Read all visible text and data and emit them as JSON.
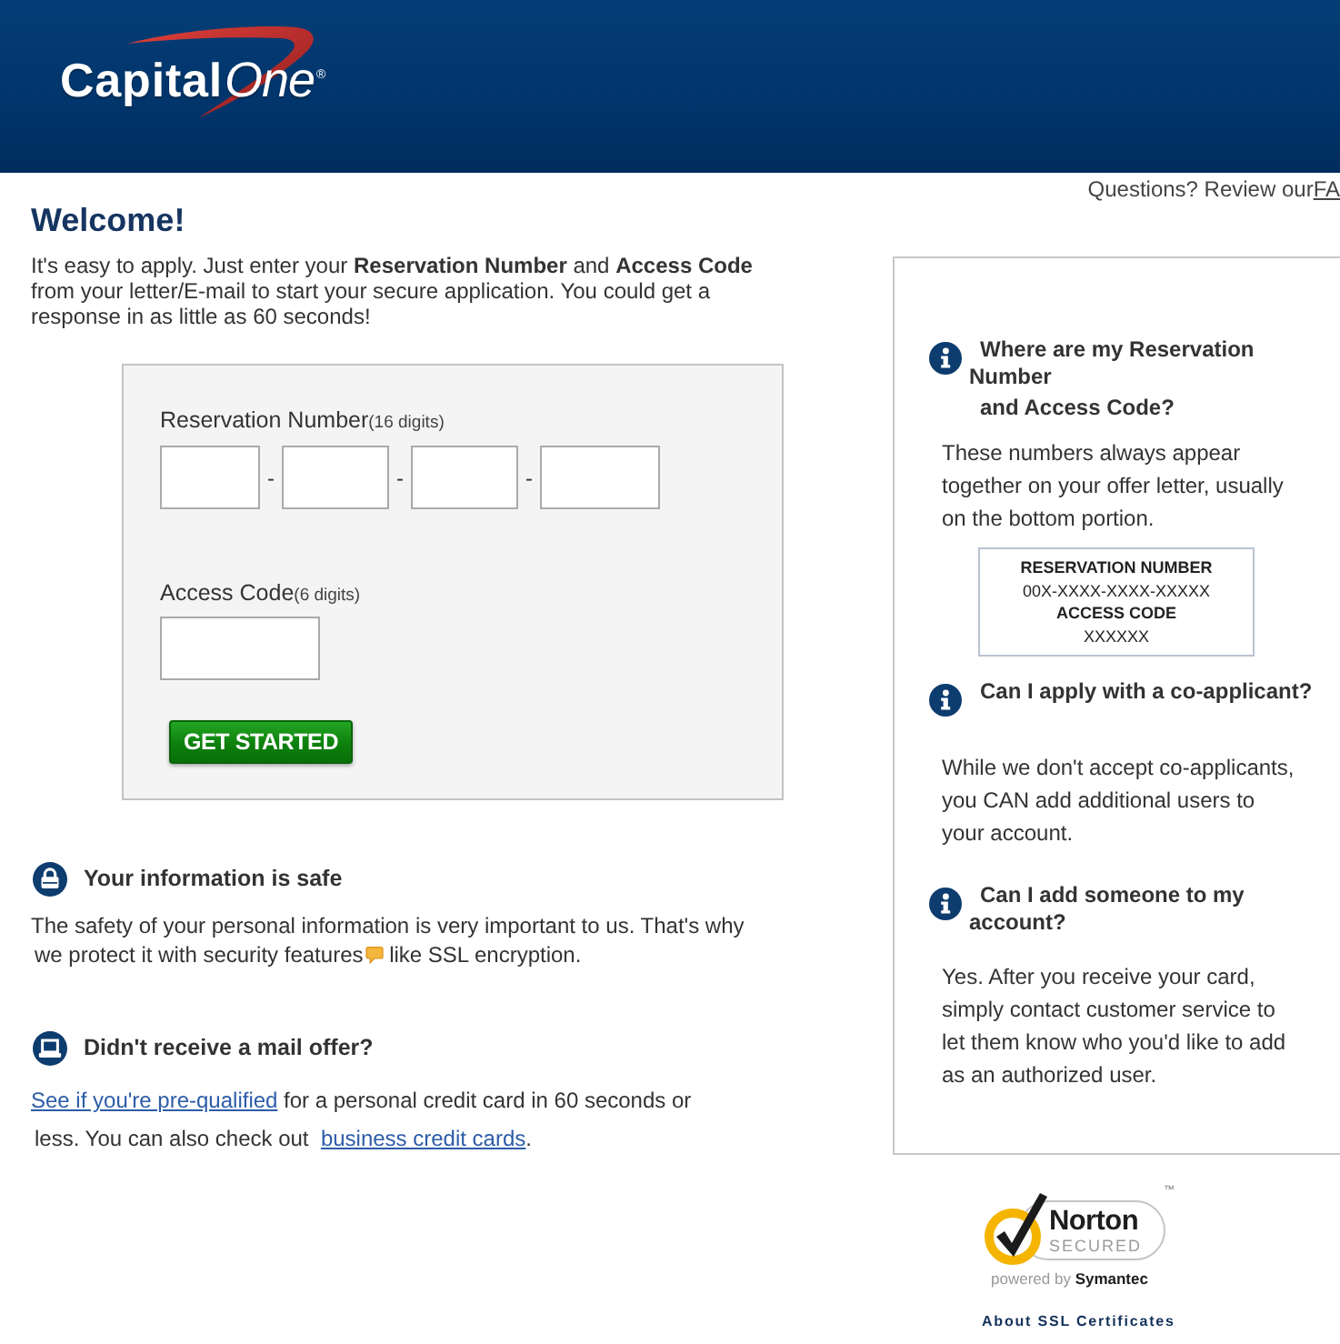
{
  "header": {
    "logo": {
      "bold": "Capital",
      "light": "One",
      "mark": "®"
    }
  },
  "help_bar": {
    "text": "Questions? Review our",
    "link": "FA"
  },
  "welcome": {
    "title": "Welcome!",
    "intro": "It's easy to apply. Just enter your **Reservation Number** and **Access Code** from your letter/E-mail to start your secure application. You could get a response in as little as 60 seconds!"
  },
  "form": {
    "reservation": {
      "label": "Reservation Number",
      "hint": "(16 digits)",
      "separators": [
        "-",
        "-",
        "-"
      ]
    },
    "access_code": {
      "label": "Access Code",
      "hint": "(6 digits)"
    },
    "submit": "GET STARTED"
  },
  "info_sections": [
    {
      "kind": "lock",
      "title": "Your information is safe",
      "lines": [
        [
          {
            "kind": "text",
            "text": "The safety of your personal information is very important to us. That's why"
          }
        ],
        [
          {
            "kind": "text",
            "text": "we protect it with security features"
          },
          {
            "kind": "icon"
          },
          {
            "kind": "text",
            "text": " like SSL encryption."
          }
        ]
      ]
    },
    {
      "kind": "laptop",
      "title": "Didn't receive a mail offer?",
      "lines": [
        [
          {
            "kind": "link",
            "text": "See if you're pre-qualified"
          },
          {
            "kind": "text",
            "text": " for a personal credit card in 60 seconds or"
          }
        ],
        [
          {
            "kind": "text",
            "text": "less. You can also check out  "
          },
          {
            "kind": "link",
            "text": "business credit cards"
          },
          {
            "kind": "text",
            "text": "."
          }
        ]
      ]
    }
  ],
  "faq": [
    {
      "question": [
        "Where are my Reservation Number",
        "and Access Code?"
      ],
      "answer": "These numbers always appear together on your offer letter, usually on the bottom portion.",
      "sample": [
        {
          "kind": "heading",
          "text": "RESERVATION NUMBER"
        },
        {
          "kind": "value",
          "text": "00X-XXXX-XXXX-XXXXX"
        },
        {
          "kind": "heading",
          "text": "ACCESS CODE"
        },
        {
          "kind": "value",
          "text": "XXXXXX"
        }
      ]
    },
    {
      "question": [
        "Can I apply with a co-applicant?"
      ],
      "answer": "While we don't accept co-applicants, you CAN add additional users to your account."
    },
    {
      "question": [
        "Can I add someone to my account?"
      ],
      "answer": "Yes. After you receive your card, simply contact customer service to let them know who you'd like to add as an authorized user."
    }
  ],
  "norton": {
    "brand": "Norton",
    "status": "SECURED",
    "trademark": "™",
    "powered_by": "powered by **Symantec**",
    "link": "About SSL Certificates"
  }
}
